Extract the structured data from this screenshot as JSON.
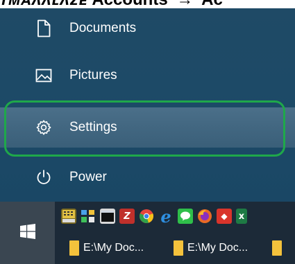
{
  "caption": {
    "prefix": "ᴛᴍᴀᴧᴧʟᴧᴢᴇ",
    "path": "Accounts",
    "arrow": "→",
    "tail": "Ac"
  },
  "start_menu": {
    "items": [
      {
        "label": "Documents",
        "icon": "document-icon"
      },
      {
        "label": "Pictures",
        "icon": "pictures-icon"
      },
      {
        "label": "Settings",
        "icon": "gear-icon"
      },
      {
        "label": "Power",
        "icon": "power-icon"
      }
    ],
    "highlighted_item": "Settings",
    "highlight_color": "#1fa84a",
    "background_color": "#1f4a66"
  },
  "taskbar": {
    "start_icon": "windows-logo-icon",
    "quick_launch": [
      {
        "name": "calculator-app-icon",
        "glyph": "",
        "color": "#c9a227"
      },
      {
        "name": "network-app-icon",
        "glyph": "",
        "color": "#3d8bd4"
      },
      {
        "name": "terminal-app-icon",
        "glyph": "",
        "color": "#2a2a2a"
      },
      {
        "name": "filezilla-icon",
        "glyph": "Z",
        "color": "#c0302b"
      },
      {
        "name": "chrome-icon",
        "glyph": "",
        "color": "#e0b032"
      },
      {
        "name": "edge-icon",
        "glyph": "e",
        "color": "#2e8fe0"
      },
      {
        "name": "line-icon",
        "glyph": "",
        "color": "#2fbf4a"
      },
      {
        "name": "firefox-icon",
        "glyph": "",
        "color": "#e86a26"
      },
      {
        "name": "red-app-icon",
        "glyph": "◆",
        "color": "#d9342b"
      },
      {
        "name": "excel-icon",
        "glyph": "x",
        "color": "#1e7a44"
      }
    ],
    "task_buttons": [
      {
        "label": "E:\\My Doc..."
      },
      {
        "label": "E:\\My Doc..."
      },
      {
        "label": ""
      }
    ]
  }
}
